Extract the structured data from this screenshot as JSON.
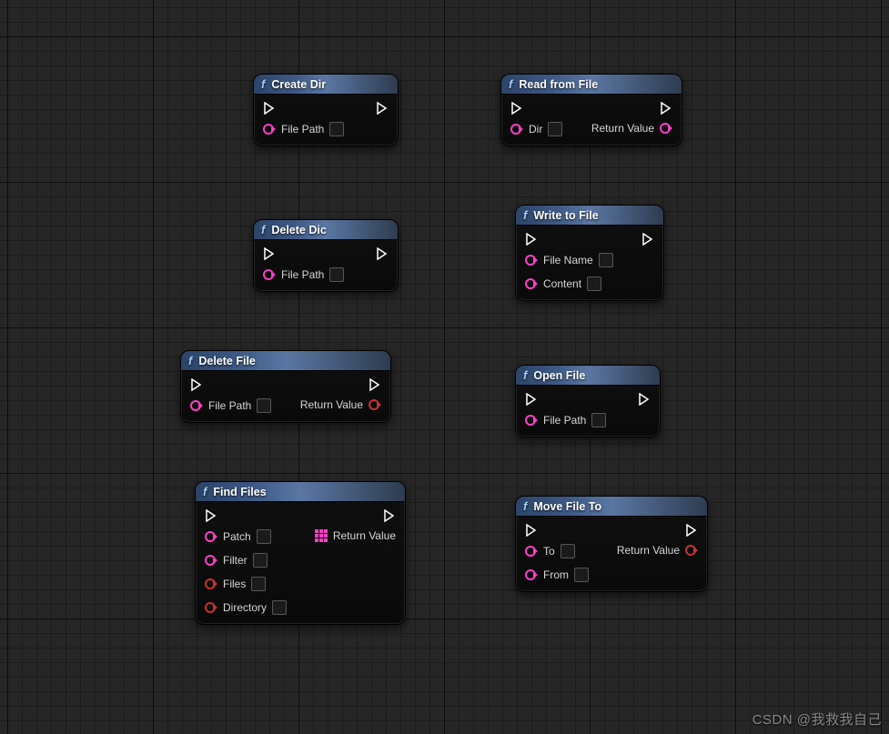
{
  "watermark": "CSDN @我救我自己",
  "labels": {
    "return_value": "Return Value",
    "file_path": "File Path",
    "dir": "Dir",
    "file_name": "File Name",
    "content": "Content",
    "patch": "Patch",
    "filter": "Filter",
    "files": "Files",
    "directory": "Directory",
    "to": "To",
    "from": "From"
  },
  "nodes": {
    "create_dir": {
      "title": "Create Dir"
    },
    "read_from_file": {
      "title": "Read from File"
    },
    "delete_dic": {
      "title": "Delete Dic"
    },
    "write_to_file": {
      "title": "Write to File"
    },
    "delete_file": {
      "title": "Delete File"
    },
    "open_file": {
      "title": "Open File"
    },
    "find_files": {
      "title": "Find Files"
    },
    "move_file_to": {
      "title": "Move File To"
    }
  }
}
